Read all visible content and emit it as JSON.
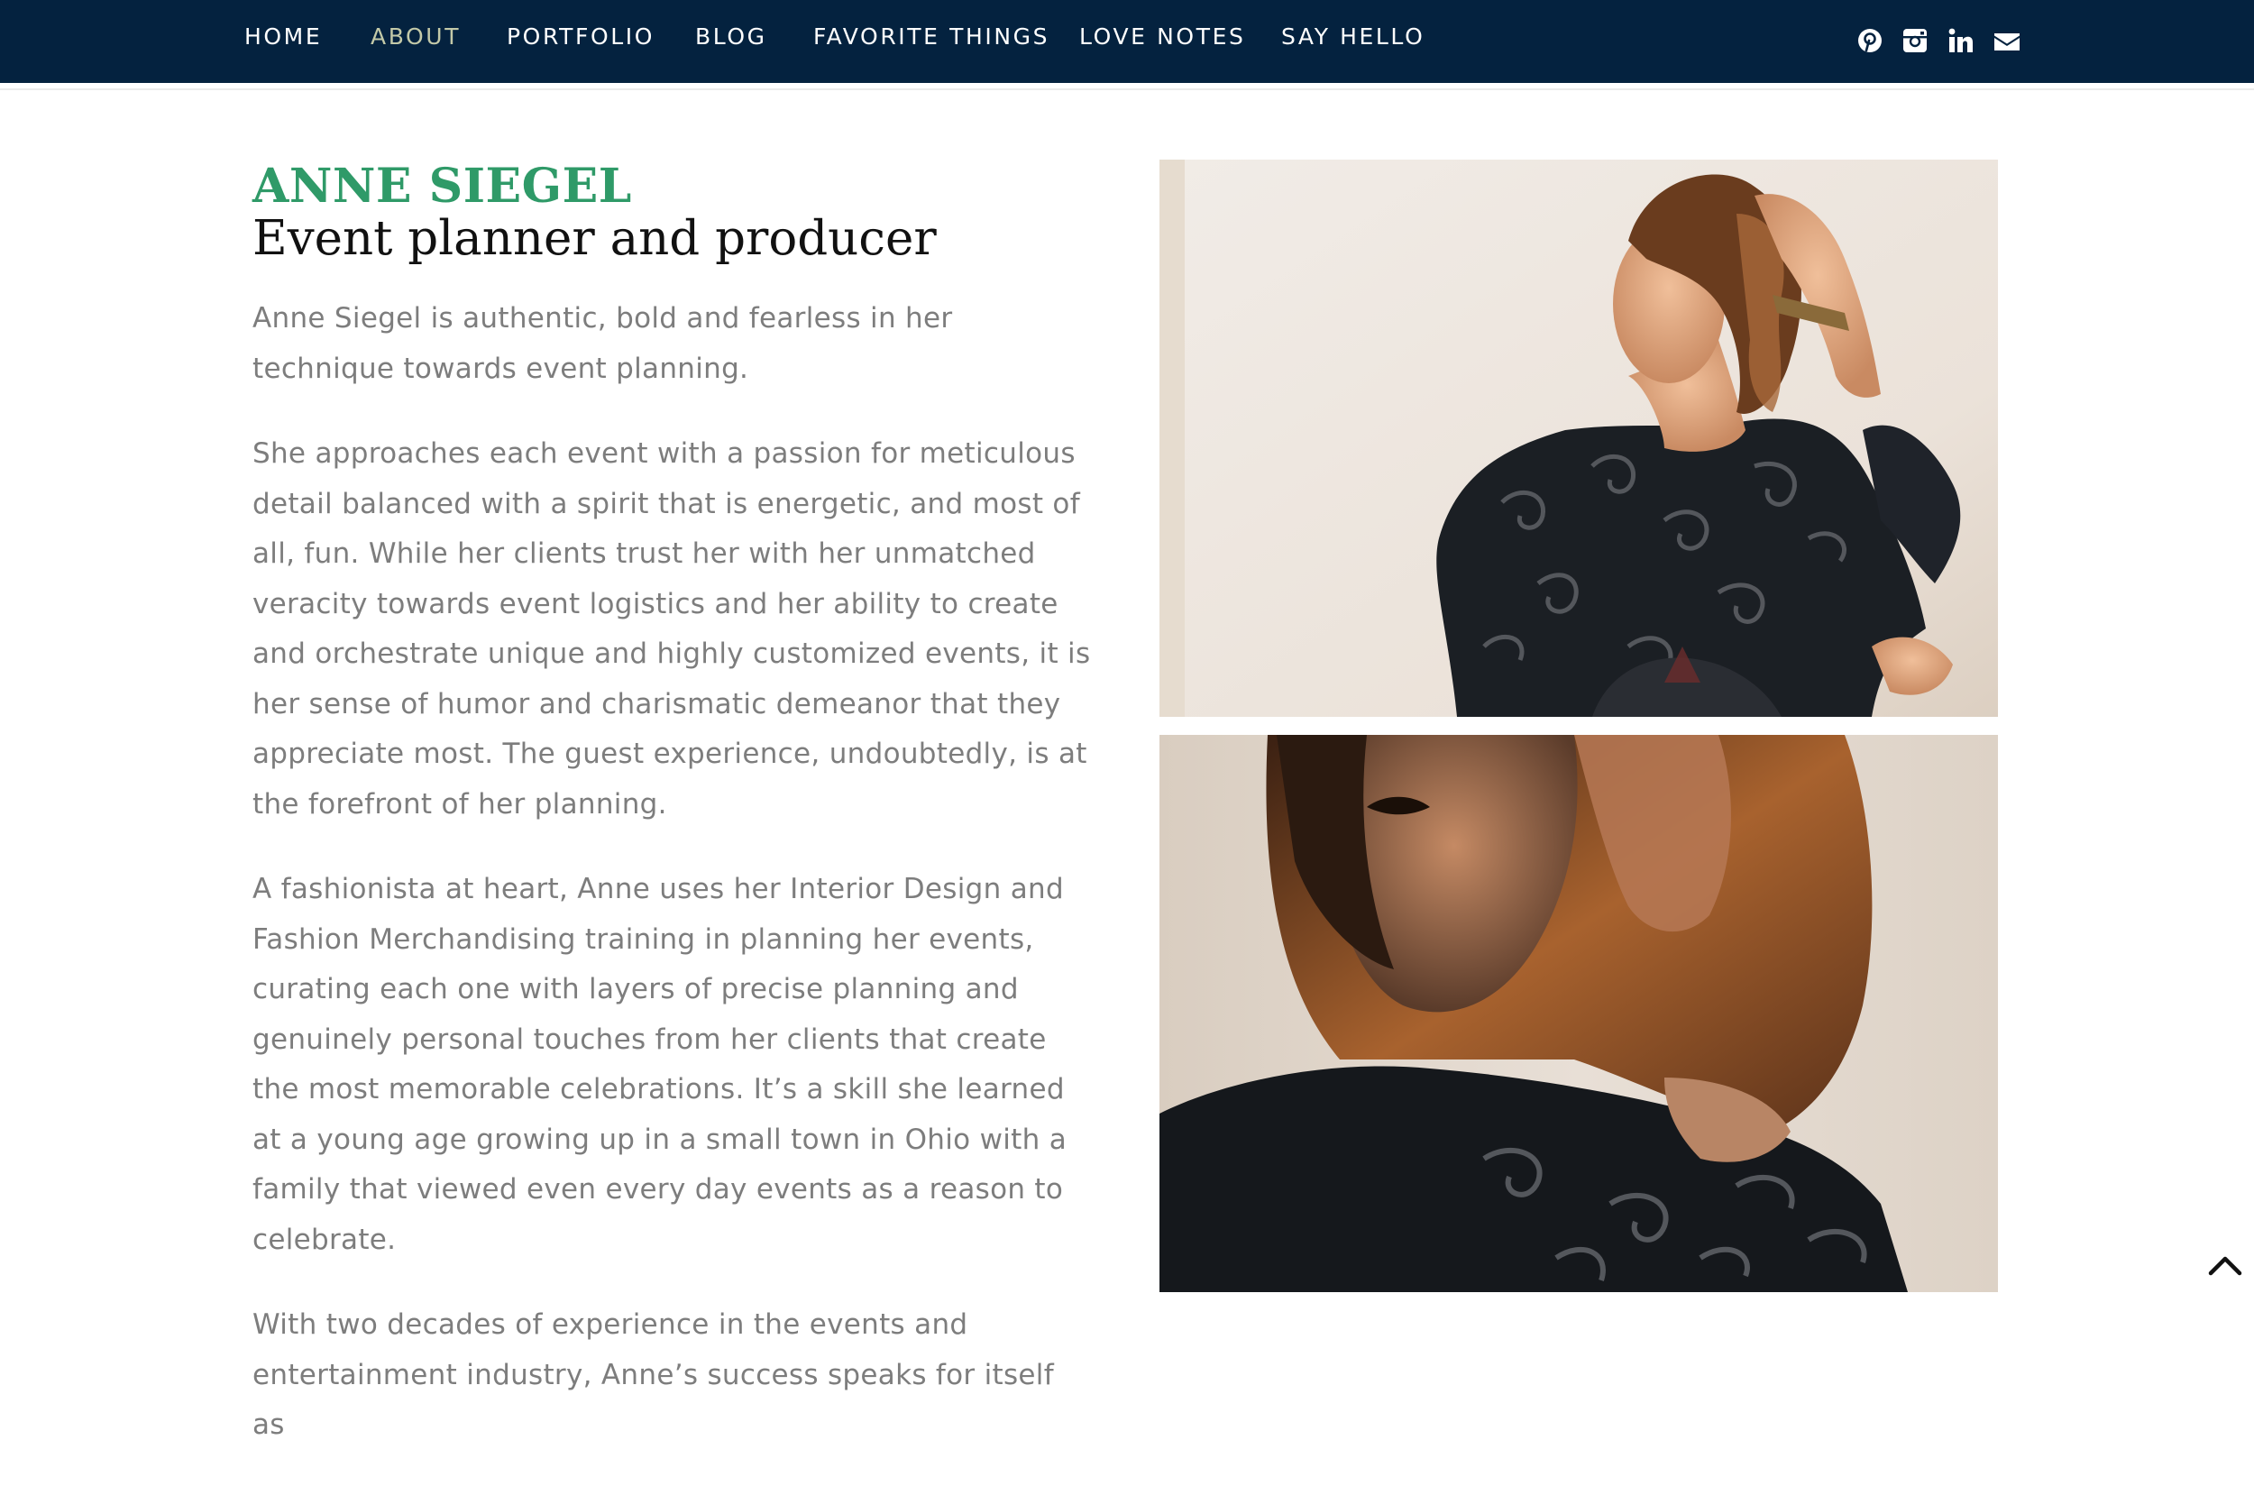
{
  "colors": {
    "navbar_background": "#04223f",
    "nav_text": "#ffffff",
    "nav_active": "#c3c9a8",
    "name_accent": "#2f9a68",
    "heading_text": "#111111",
    "body_text": "#7d7d7d"
  },
  "nav": {
    "items": [
      {
        "label": "HOME"
      },
      {
        "label": "ABOUT",
        "active": true
      },
      {
        "label": "PORTFOLIO"
      },
      {
        "label": "BLOG"
      },
      {
        "label": "FAVORITE THINGS"
      },
      {
        "label": "LOVE NOTES"
      },
      {
        "label": "SAY HELLO"
      }
    ],
    "social_icons": [
      "pinterest-icon",
      "instagram-icon",
      "linkedin-icon",
      "email-icon"
    ]
  },
  "profile": {
    "name": "ANNE SIEGEL",
    "role": "Event planner and producer",
    "bio": [
      "Anne Siegel is authentic, bold and fearless in her technique towards event planning.",
      "She approaches each event with a passion for meticulous detail balanced with a spirit that is energetic, and most of all, fun. While her clients trust her with her unmatched veracity towards event logistics and her ability to create and orchestrate unique and highly customized events, it is her sense of humor and charismatic demeanor that they appreciate most. The guest experience, undoubtedly, is at the forefront of her planning.",
      "A fashionista at heart, Anne uses her Interior Design and Fashion Merchandising training in planning her events, curating each one with layers of precise planning and genuinely personal touches from her clients that create the most memorable celebrations. It’s a skill she learned at a young age growing up in a small town in Ohio with a family that viewed even every day events as a reason to celebrate.",
      "With two decades of experience in the events and entertainment industry, Anne’s success speaks for itself as"
    ]
  },
  "photos": [
    {
      "name": "portrait-photo-looking-away"
    },
    {
      "name": "portrait-photo-over-shoulder"
    }
  ],
  "back_to_top_icon": "chevron-up-icon"
}
